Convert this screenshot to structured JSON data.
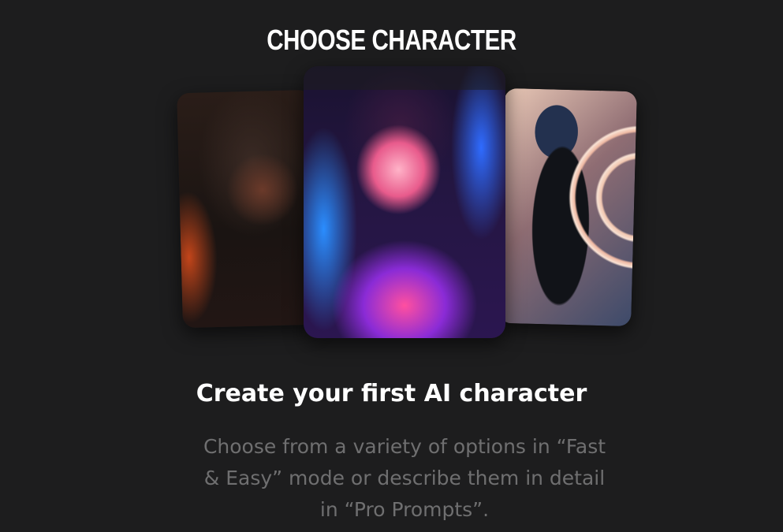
{
  "screen": {
    "title": "CHOOSE CHARACTER",
    "heading": "Create your first AI character",
    "description": "Choose from a variety of options in “Fast & Easy” mode or describe them in detail in “Pro Prompts”."
  },
  "carousel": {
    "cards": [
      {
        "label": "character-man-glasses"
      },
      {
        "label": "character-woman-neon"
      },
      {
        "label": "character-anime-woman"
      }
    ]
  },
  "colors": {
    "background": "#1d1d1e",
    "title_text": "#ffffff",
    "body_text": "#6f6f70"
  }
}
